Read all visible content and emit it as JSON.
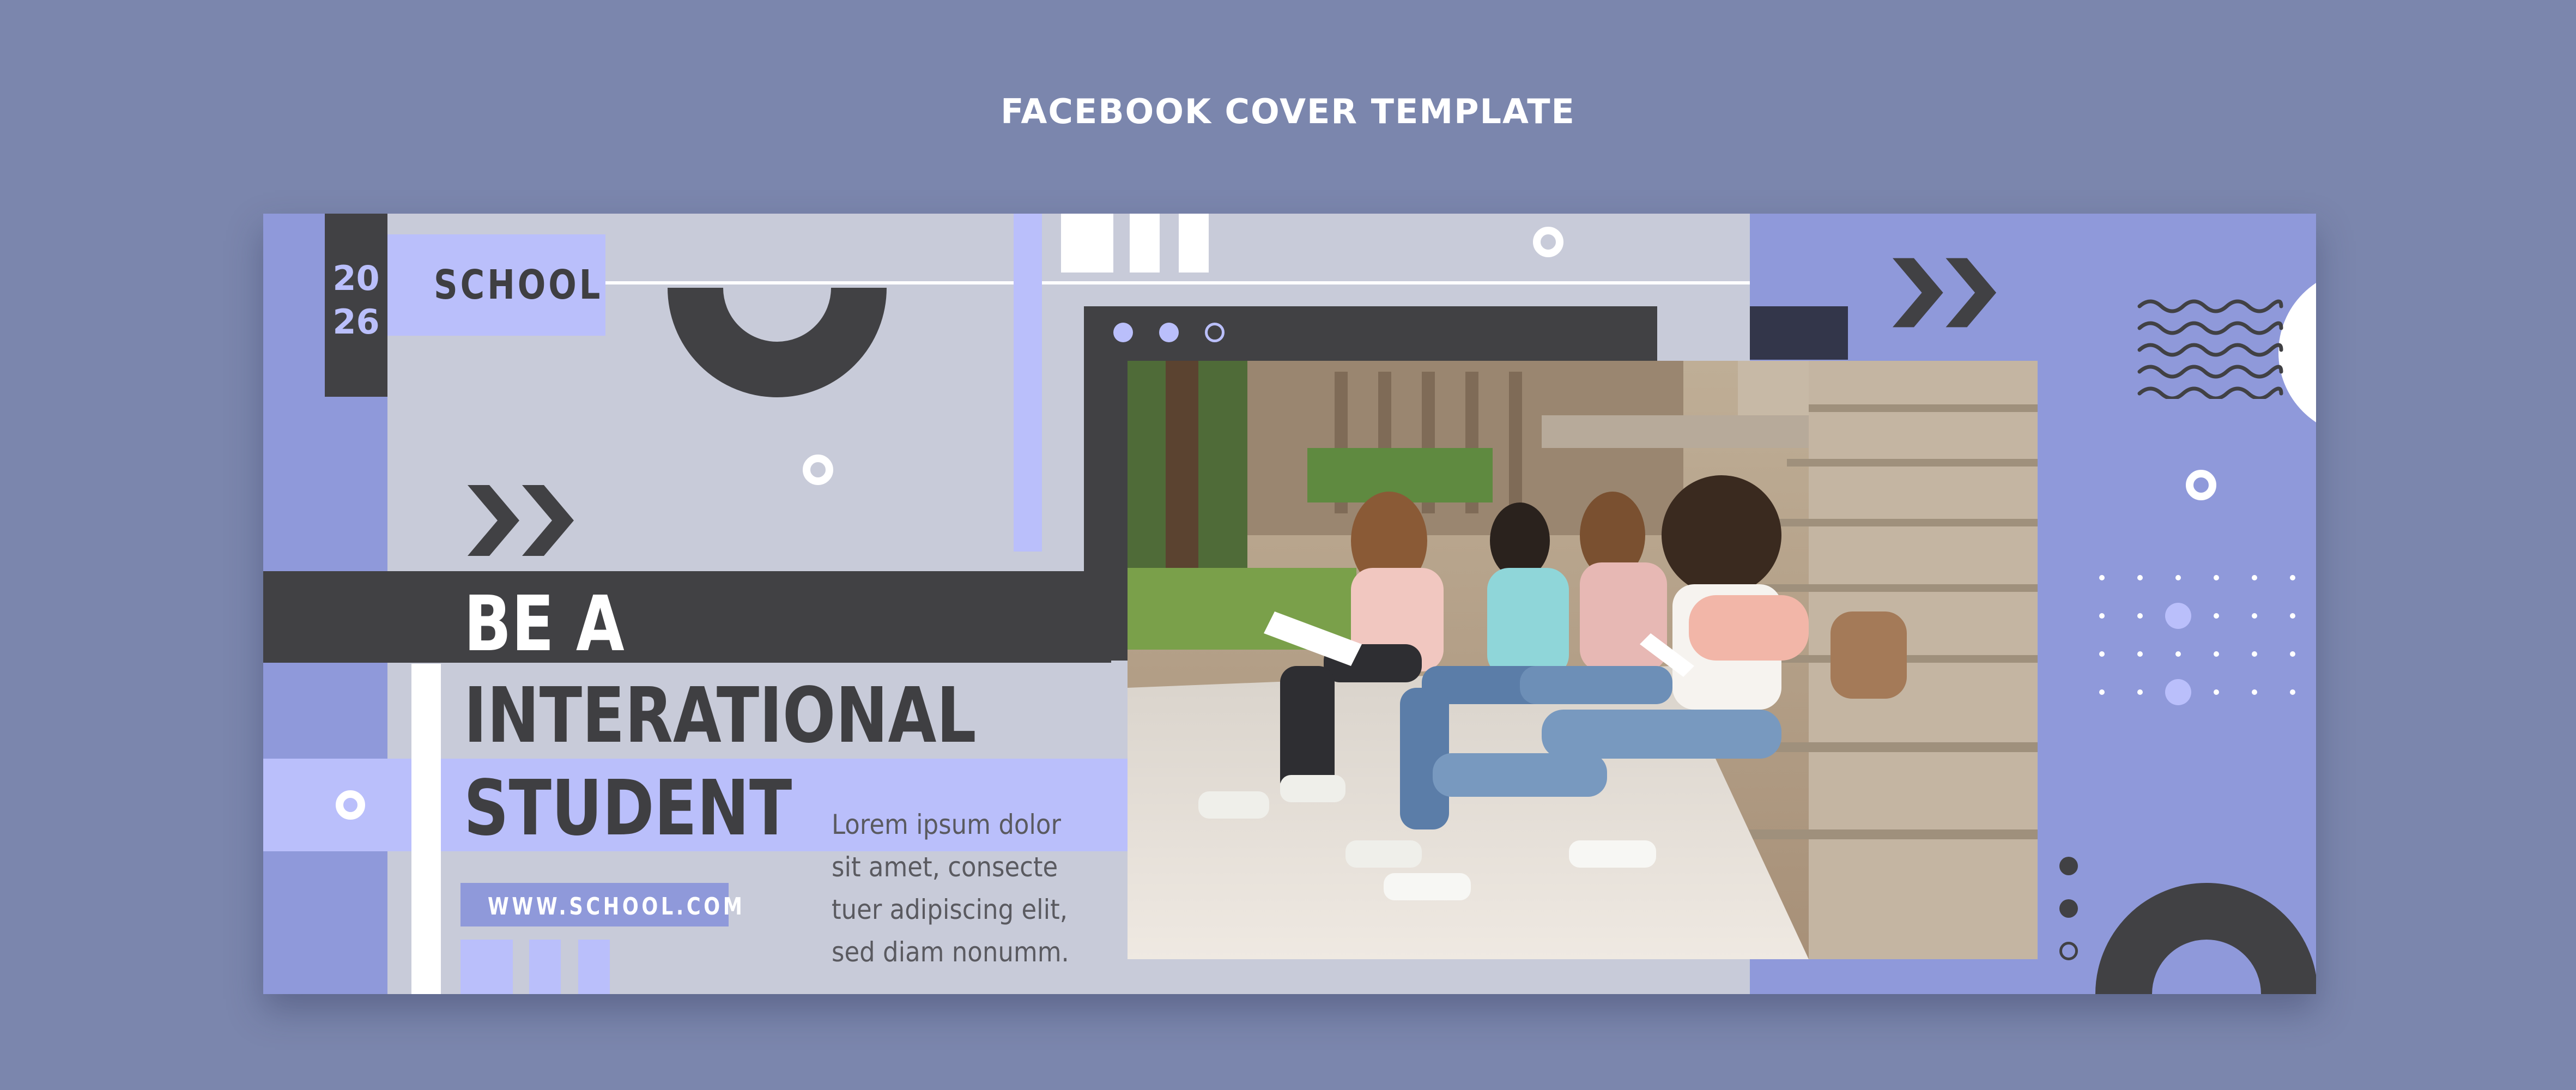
{
  "header": {
    "title": "FACEBOOK COVER TEMPLATE"
  },
  "cover": {
    "year_top": "20",
    "year_bottom": "26",
    "school_label": "SCHOOL",
    "headline": [
      "BE A",
      "INTERATIONAL",
      "STUDENT"
    ],
    "website": "WWW.SCHOOL.COM",
    "body_lines": [
      "Lorem ipsum dolor",
      "sit amet, consecte",
      "tuer adipiscing elit,",
      "sed diam nonumm."
    ]
  },
  "colors": {
    "page_background": "#7b86ad",
    "banner_background": "#c8cbd9",
    "dark": "#414144",
    "lavender": "#8f99da",
    "pale_lavender": "#babffb",
    "white": "#ffffff"
  },
  "photo": {
    "subject": "four students sitting on stone steps reading papers"
  }
}
